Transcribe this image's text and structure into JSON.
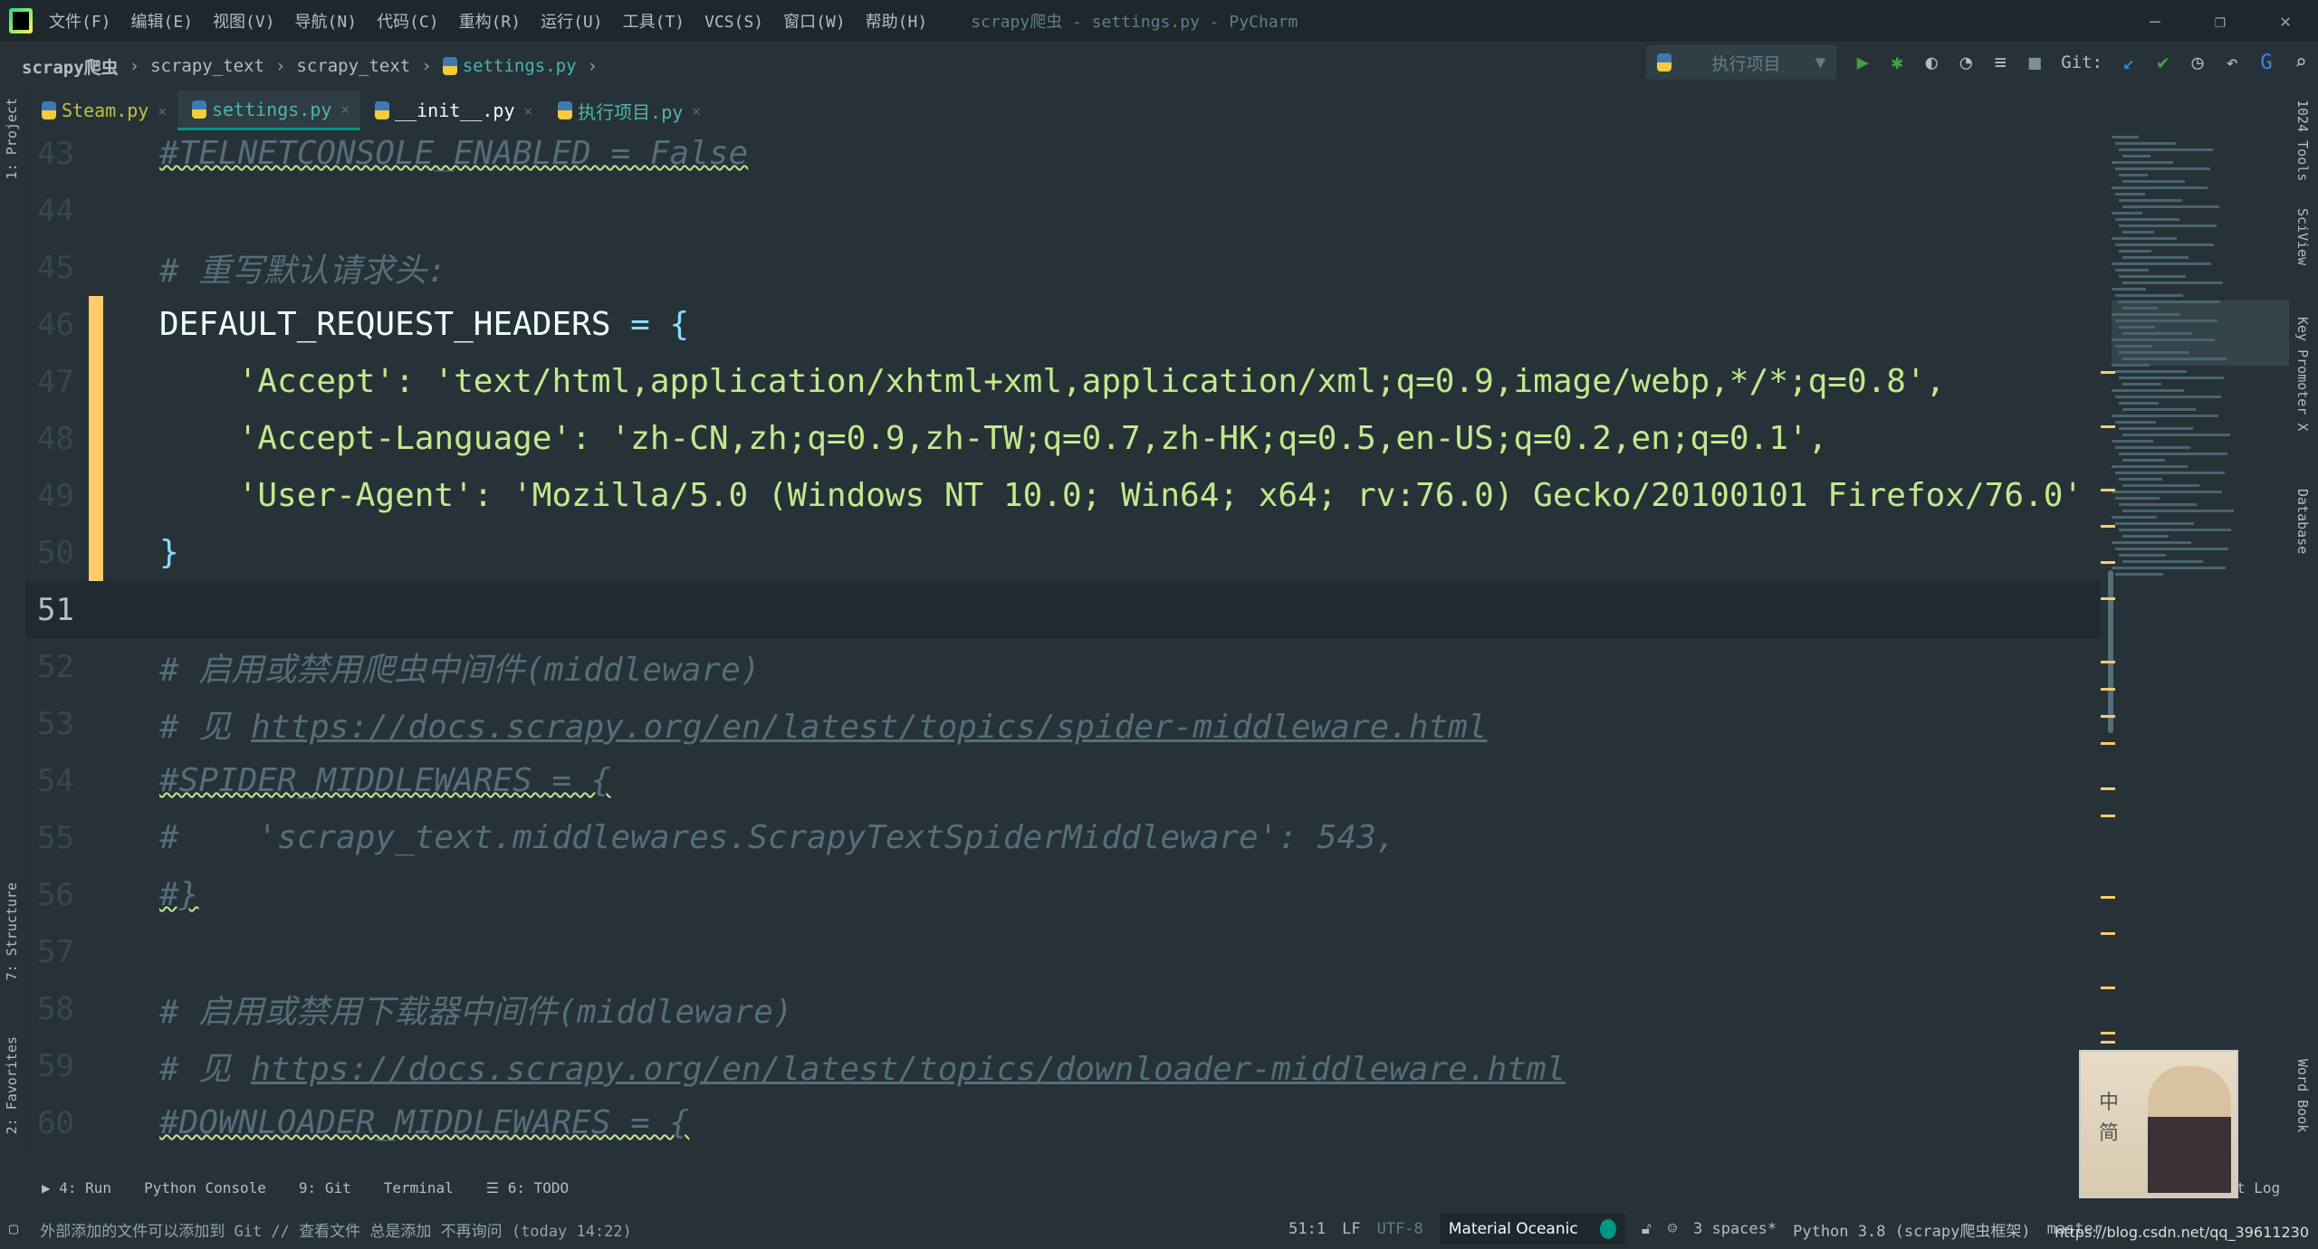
{
  "window": {
    "title": "scrapy爬虫 - settings.py - PyCharm",
    "controls": [
      "—",
      "❐",
      "✕"
    ]
  },
  "menu": [
    "文件(F)",
    "编辑(E)",
    "视图(V)",
    "导航(N)",
    "代码(C)",
    "重构(R)",
    "运行(U)",
    "工具(T)",
    "VCS(S)",
    "窗口(W)",
    "帮助(H)"
  ],
  "breadcrumb": [
    "scrapy爬虫",
    "scrapy_text",
    "scrapy_text",
    "settings.py"
  ],
  "toolbar": {
    "run_config": "执行项目",
    "git_label": "Git:"
  },
  "tabs": [
    {
      "label": "Steam.py",
      "color": "#c0c040"
    },
    {
      "label": "settings.py",
      "color": "#4fb3b3",
      "active": true
    },
    {
      "label": "__init__.py",
      "color": "#eeffff"
    },
    {
      "label": "执行项目.py",
      "color": "#4fb3b3"
    }
  ],
  "left_tools": [
    "1: Project",
    "7: Structure",
    "2: Favorites"
  ],
  "right_tools": [
    "1024 Tools",
    "SciView",
    "Key Promoter X",
    "Database",
    "Word Book"
  ],
  "code": {
    "lines": [
      {
        "n": "43",
        "text": "#TELNETCONSOLE_ENABLED = False",
        "kind": "cmwav"
      },
      {
        "n": "44",
        "text": "",
        "kind": "plain"
      },
      {
        "n": "45",
        "text": "# 重写默认请求头:",
        "kind": "cm"
      },
      {
        "n": "46",
        "text": "DEFAULT_REQUEST_HEADERS = {",
        "kind": "plain",
        "mod": true
      },
      {
        "n": "47",
        "text": "    'Accept': 'text/html,application/xhtml+xml,application/xml;q=0.9,image/webp,*/*;q=0.8',",
        "kind": "str",
        "mod": true
      },
      {
        "n": "48",
        "text": "    'Accept-Language': 'zh-CN,zh;q=0.9,zh-TW;q=0.7,zh-HK;q=0.5,en-US;q=0.2,en;q=0.1',",
        "kind": "str",
        "mod": true
      },
      {
        "n": "49",
        "text": "    'User-Agent': 'Mozilla/5.0 (Windows NT 10.0; Win64; x64; rv:76.0) Gecko/20100101 Firefox/76.0'",
        "kind": "str",
        "mod": true
      },
      {
        "n": "50",
        "text": "}",
        "kind": "pun",
        "mod": true
      },
      {
        "n": "51",
        "text": "",
        "kind": "plain",
        "current": true
      },
      {
        "n": "52",
        "text": "# 启用或禁用爬虫中间件(middleware)",
        "kind": "cm"
      },
      {
        "n": "53",
        "text": "# 见 https://docs.scrapy.org/en/latest/topics/spider-middleware.html",
        "kind": "cmlink"
      },
      {
        "n": "54",
        "text": "#SPIDER_MIDDLEWARES = {",
        "kind": "cmwav"
      },
      {
        "n": "55",
        "text": "#    'scrapy_text.middlewares.ScrapyTextSpiderMiddleware': 543,",
        "kind": "cm"
      },
      {
        "n": "56",
        "text": "#}",
        "kind": "cmwav"
      },
      {
        "n": "57",
        "text": "",
        "kind": "plain"
      },
      {
        "n": "58",
        "text": "# 启用或禁用下载器中间件(middleware)",
        "kind": "cm"
      },
      {
        "n": "59",
        "text": "# 见 https://docs.scrapy.org/en/latest/topics/downloader-middleware.html",
        "kind": "cmlink"
      },
      {
        "n": "60",
        "text": "#DOWNLOADER_MIDDLEWARES = {",
        "kind": "cmwav"
      }
    ]
  },
  "bottom_tools": [
    "▶ 4: Run",
    "Python Console",
    "9: Git",
    "Terminal",
    "☰ 6: TODO",
    "t Log"
  ],
  "status": {
    "message": "外部添加的文件可以添加到 Git // 查看文件    总是添加    不再询问 (today 14:22)",
    "position": "51:1",
    "line_sep": "LF",
    "encoding": "UTF-8",
    "theme": "Material Oceanic",
    "indent": "3 spaces*",
    "interpreter": "Python 3.8 (scrapy爬虫框架)",
    "branch": "master"
  },
  "avatar_text": [
    "中",
    "简"
  ],
  "watermark": "https://blog.csdn.net/qq_39611230",
  "colors": {
    "background": "#263238",
    "string": "#c3e88d",
    "comment": "#546e7a",
    "modified": "#ffcb6b",
    "accent": "#009688"
  }
}
